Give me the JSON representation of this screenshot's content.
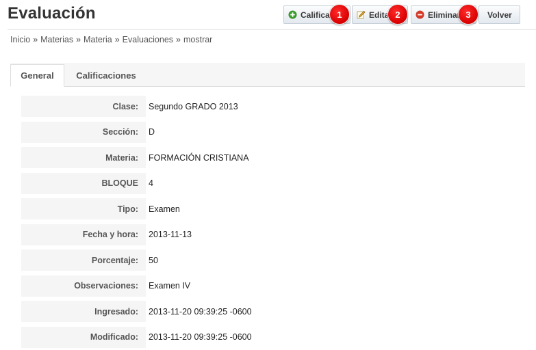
{
  "header": {
    "title": "Evaluación",
    "buttons": {
      "calificar": "Calificar",
      "editar": "Editar",
      "eliminar": "Eliminar",
      "volver": "Volver"
    },
    "badges": [
      "1",
      "2",
      "3"
    ]
  },
  "breadcrumb": [
    "Inicio",
    "Materias",
    "Materia",
    "Evaluaciones",
    "mostrar"
  ],
  "breadcrumb_separator": "»",
  "tabs": [
    {
      "label": "General",
      "active": true
    },
    {
      "label": "Calificaciones",
      "active": false
    }
  ],
  "details": [
    {
      "label": "Clase:",
      "value": "Segundo GRADO 2013"
    },
    {
      "label": "Sección:",
      "value": "D"
    },
    {
      "label": "Materia:",
      "value": "FORMACIÓN CRISTIANA"
    },
    {
      "label": "BLOQUE",
      "value": "4"
    },
    {
      "label": "Tipo:",
      "value": "Examen"
    },
    {
      "label": "Fecha y hora:",
      "value": "2013-11-13"
    },
    {
      "label": "Porcentaje:",
      "value": "50"
    },
    {
      "label": "Observaciones:",
      "value": "Examen IV"
    },
    {
      "label": "Ingresado:",
      "value": "2013-11-20 09:39:25 -0600"
    },
    {
      "label": "Modificado:",
      "value": "2013-11-20 09:39:25 -0600"
    }
  ],
  "icons": {
    "calificar": "add-circle-icon",
    "editar": "edit-pencil-icon",
    "eliminar": "delete-circle-icon"
  },
  "colors": {
    "badge": "#d80000",
    "add_icon": "#3a9b2a",
    "delete_icon": "#d23a2a"
  }
}
